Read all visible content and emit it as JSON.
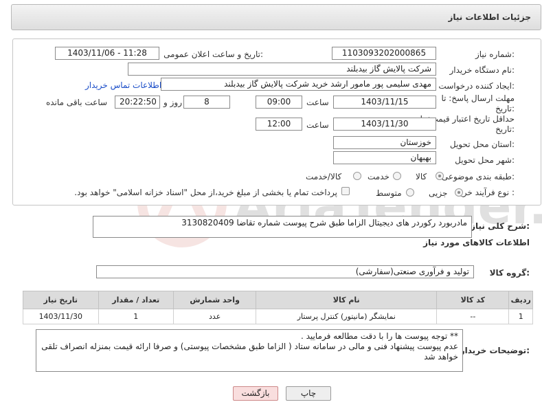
{
  "header": {
    "title": "جزئیات اطلاعات نیاز"
  },
  "form": {
    "need_number": {
      "label": "شماره نیاز:",
      "value": "1103093202000865"
    },
    "announce_datetime": {
      "label": "تاریخ و ساعت اعلان عمومی:",
      "value": "1403/11/06 - 11:28"
    },
    "buyer_org": {
      "label": "نام دستگاه خریدار:",
      "value": "شرکت پالایش گاز بیدبلند"
    },
    "requester": {
      "label": "ایجاد کننده درخواست:",
      "value": "مهدی سلیمی پور مامور ارشد خرید شرکت پالایش گاز بیدبلند",
      "contact_link": "اطلاعات تماس خریدار"
    },
    "deadline": {
      "label_line1": "مهلت ارسال پاسخ: تا",
      "label_line2": "تاریخ:",
      "date": "1403/11/15",
      "time_label": "ساعت",
      "time": "09:00",
      "days": "8",
      "days_label": "روز و",
      "remaining": "20:22:50",
      "remaining_label": "ساعت باقی مانده"
    },
    "price_validity": {
      "label_line1": "حداقل تاریخ اعتبار قیمت: تا",
      "label_line2": "تاریخ:",
      "date": "1403/11/30",
      "time_label": "ساعت",
      "time": "12:00"
    },
    "province": {
      "label": "استان محل تحویل:",
      "value": "خوزستان"
    },
    "city": {
      "label": "شهر محل تحویل:",
      "value": "بهبهان"
    },
    "category": {
      "label": "طبقه بندی موضوعی:",
      "options": [
        "کالا",
        "خدمت",
        "کالا/خدمت"
      ],
      "selected": "کالا"
    },
    "purchase_type": {
      "label": "نوع فرآیند خرید :",
      "options": [
        "جزیی",
        "متوسط"
      ],
      "selected": "جزیی",
      "payment_note": "پرداخت تمام یا بخشی از مبلغ خرید،از محل \"اسناد خزانه اسلامی\" خواهد بود."
    }
  },
  "summary": {
    "label": "شرح کلی نیاز:",
    "value": "مادربورد رکوردر های دیجیتال  الزاما طبق شرح پیوست شماره تقاضا 3130820409"
  },
  "goods_section": {
    "title": "اطلاعات کالاهای مورد نیاز",
    "group_label": "گروه کالا:",
    "group_value": "تولید و فرآوری صنعتی(سفارشی)"
  },
  "table": {
    "columns": [
      "ردیف",
      "کد کالا",
      "نام کالا",
      "واحد شمارش",
      "تعداد / مقدار",
      "تاریخ نیاز"
    ],
    "rows": [
      [
        "1",
        "--",
        "نمایشگر (مانیتور) کنترل پرستار",
        "عدد",
        "1",
        "1403/11/30"
      ]
    ]
  },
  "buyer_notes": {
    "label": "توضیحات خریدار:",
    "line1": "** توجه پیوست ها  را با دقت مطالعه فرمایید .",
    "line2": "عدم پیوست پیشنهاد فنی و مالی در سامانه ستاد ( الزاما طبق مشخصات پیوستی)  و صرفا ارائه قیمت بمنزله انصراف تلقی خواهد شد"
  },
  "buttons": {
    "back": "بازگشت",
    "print": "چاپ"
  },
  "colors": {
    "link": "#1a4dc8",
    "back_button_bg": "#f9dede"
  }
}
